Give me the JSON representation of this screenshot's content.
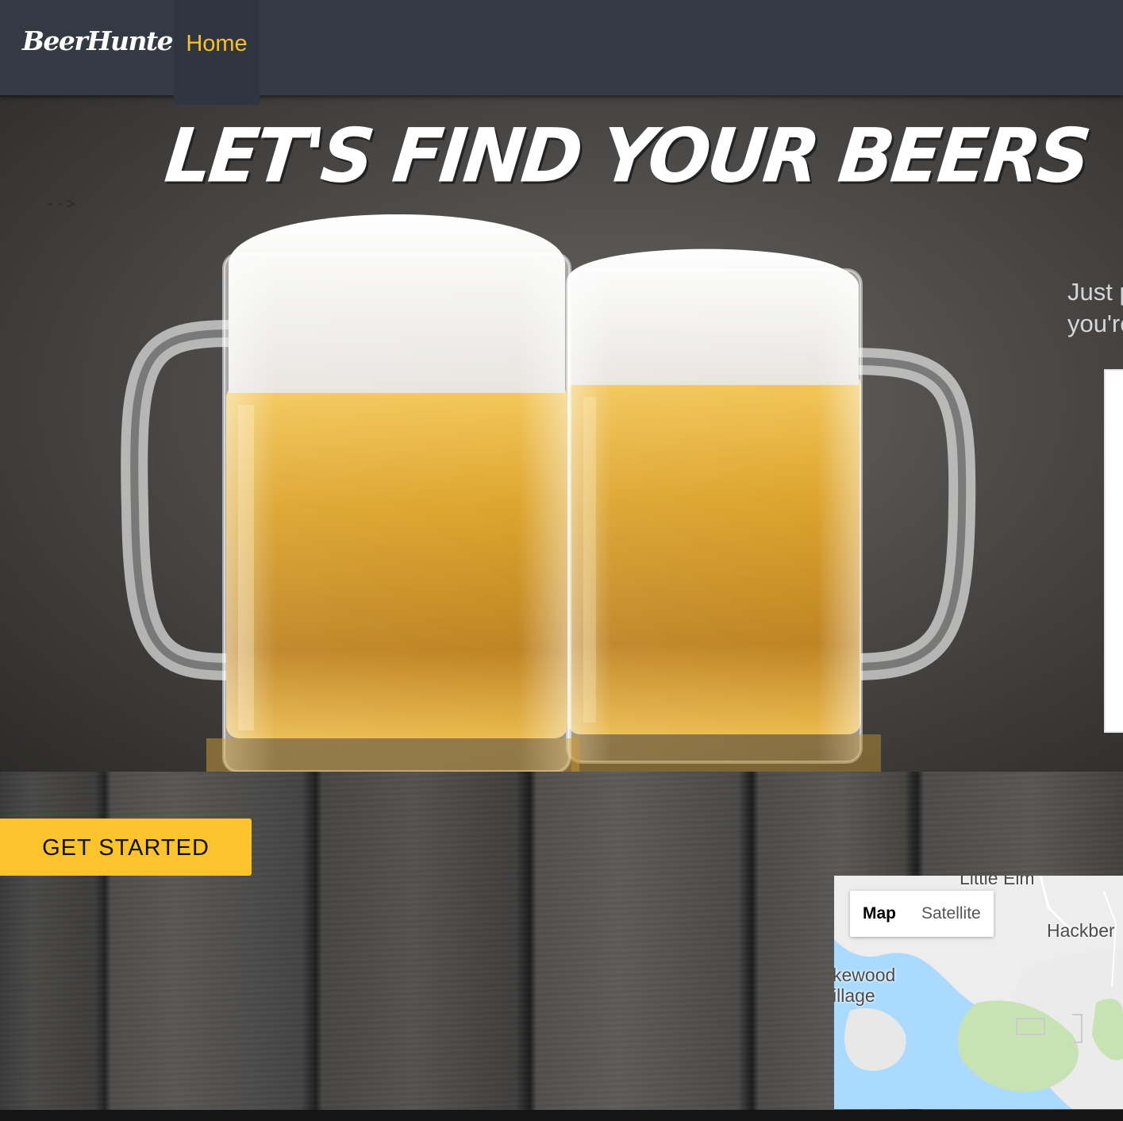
{
  "navbar": {
    "brand": "BeerHunter",
    "home_label": "Home"
  },
  "hero": {
    "title": "LET'S FIND YOUR BEERS",
    "comment_arrow": "-->",
    "tagline_line1": "Just p",
    "tagline_line2": "you're"
  },
  "cta": {
    "get_started_label": "GET STARTED"
  },
  "map": {
    "type_map_label": "Map",
    "type_satellite_label": "Satellite",
    "place_top": "Little Elm",
    "place_right": "Hackber",
    "place_left_line1": "kewood",
    "place_left_line2": "illage"
  },
  "colors": {
    "navbar_bg": "#343a44",
    "accent_yellow": "#fcc42c",
    "home_link": "#f5c02a"
  }
}
